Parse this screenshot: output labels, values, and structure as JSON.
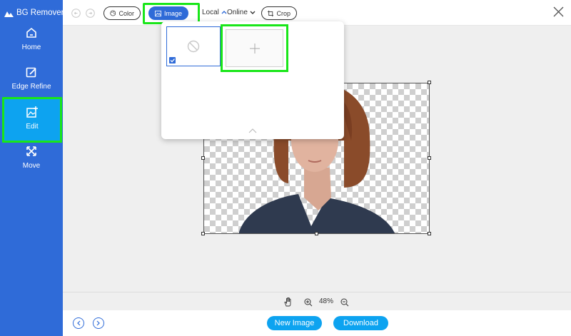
{
  "app": {
    "title": "BG Remover"
  },
  "sidebar": {
    "items": [
      {
        "label": "Home",
        "icon": "home-icon"
      },
      {
        "label": "Edge Refine",
        "icon": "edge-refine-icon"
      },
      {
        "label": "Edit",
        "icon": "edit-image-icon"
      },
      {
        "label": "Move",
        "icon": "move-icon"
      }
    ]
  },
  "toolbar": {
    "color_label": "Color",
    "image_label": "Image",
    "local_label": "Local",
    "online_label": "Online",
    "crop_label": "Crop"
  },
  "zoom": {
    "level": "48%"
  },
  "bottombar": {
    "new_image_label": "New Image",
    "download_label": "Download"
  },
  "colors": {
    "sidebar": "#2f6bd8",
    "accent": "#0da3f0",
    "highlight": "#19e619",
    "canvas_bg": "#efefef"
  }
}
